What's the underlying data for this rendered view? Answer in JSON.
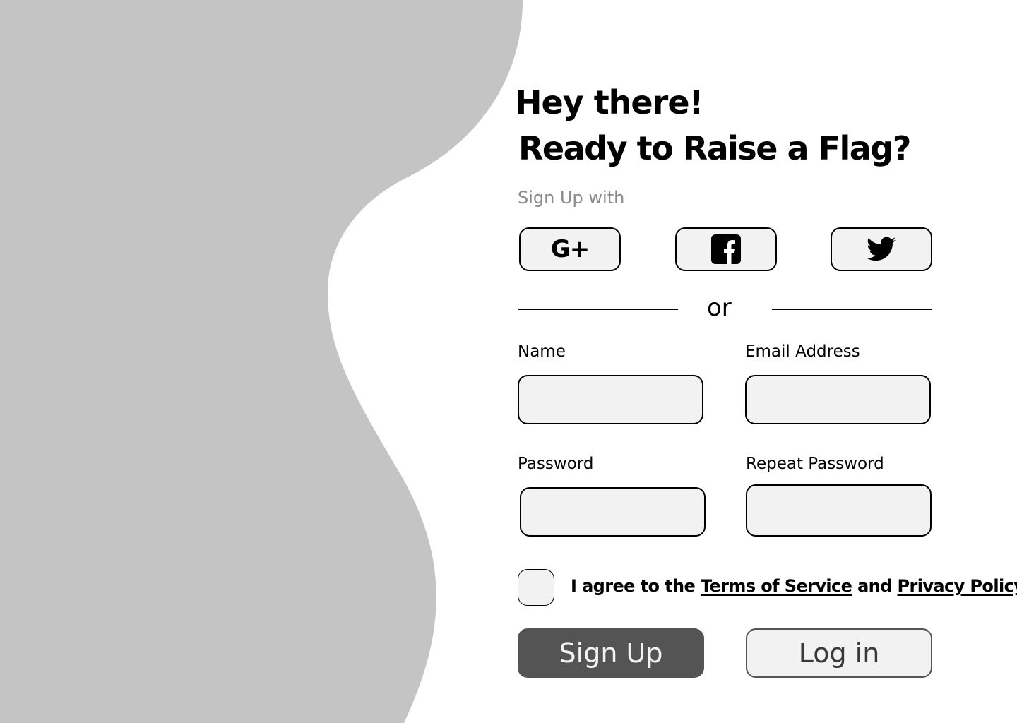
{
  "header": {
    "greeting": "Hey there!",
    "headline": "Ready to Raise a Flag?",
    "social_prompt": "Sign Up with"
  },
  "social_buttons": [
    {
      "icon": "google-plus-icon",
      "glyph": "G+"
    },
    {
      "icon": "facebook-icon"
    },
    {
      "icon": "twitter-icon"
    }
  ],
  "divider": {
    "label": "or"
  },
  "form": {
    "name": {
      "label": "Name",
      "value": "",
      "placeholder": ""
    },
    "email": {
      "label": "Email Address",
      "value": "",
      "placeholder": ""
    },
    "password": {
      "label": "Password",
      "value": "",
      "placeholder": ""
    },
    "repeat_password": {
      "label": "Repeat Password",
      "value": "",
      "placeholder": ""
    }
  },
  "agreement": {
    "checked": false,
    "prefix": "I agree to the ",
    "terms_link": "Terms of Service",
    "conjunction": " and ",
    "privacy_link": "Privacy Policy"
  },
  "actions": {
    "signup_label": "Sign Up",
    "login_label": "Log in"
  },
  "colors": {
    "blob": "#c4c4c4",
    "field_bg": "#f2f2f2",
    "primary_button": "#545454",
    "muted_text": "#8a8a8a"
  }
}
